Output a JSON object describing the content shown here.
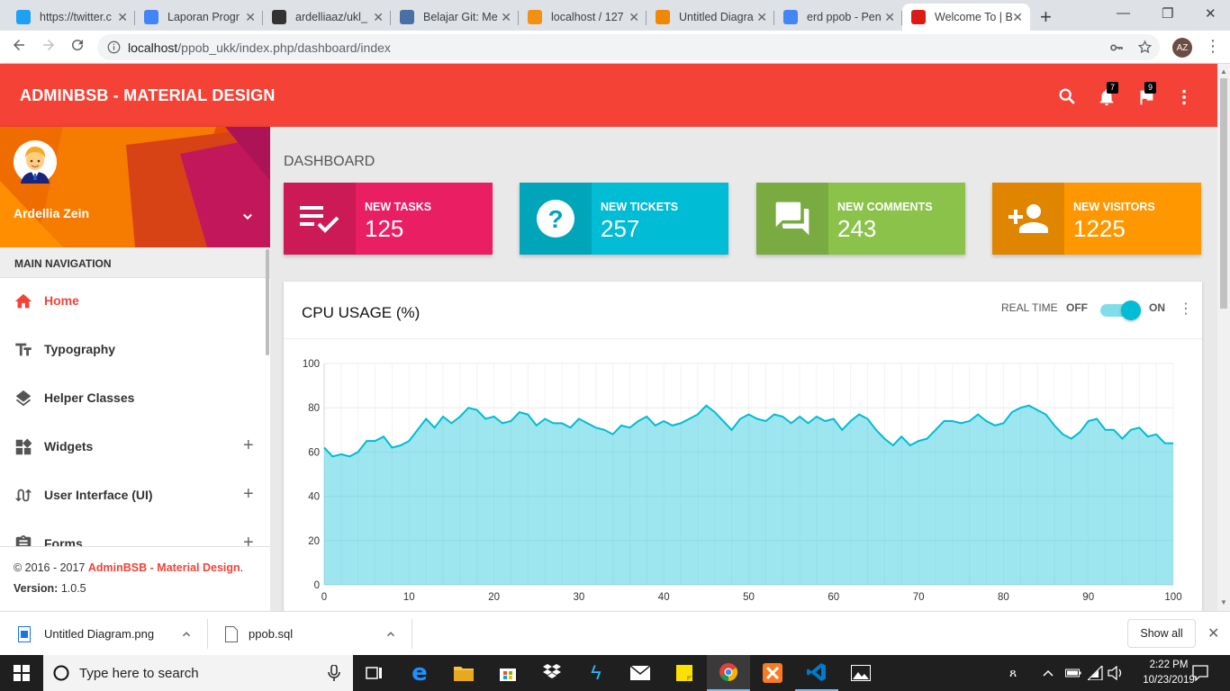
{
  "browser": {
    "tabs": [
      {
        "title": "https://twitter.c",
        "icon": "twitter-icon",
        "color": "#1da1f2"
      },
      {
        "title": "Laporan Progr",
        "icon": "docs-icon",
        "color": "#4285f4"
      },
      {
        "title": "ardelliaaz/ukl_",
        "icon": "github-icon",
        "color": "#333333"
      },
      {
        "title": "Belajar Git: Me",
        "icon": "page-icon",
        "color": "#4a6fa5"
      },
      {
        "title": "localhost / 127",
        "icon": "phpmyadmin-icon",
        "color": "#f29111"
      },
      {
        "title": "Untitled Diagra",
        "icon": "drawio-icon",
        "color": "#f08705"
      },
      {
        "title": "erd ppob - Pen",
        "icon": "google-icon",
        "color": "#4285f4"
      },
      {
        "title": "Welcome To | B",
        "icon": "angular-icon",
        "color": "#dd1b16"
      }
    ],
    "url_host": "localhost",
    "url_path": "/ppob_ukk/index.php/dashboard/index",
    "profile_initials": "AZ"
  },
  "app": {
    "brand": "ADMINBSB - MATERIAL DESIGN",
    "notifications_count": "7",
    "flags_count": "9",
    "accent": "#f44336"
  },
  "sidebar": {
    "user_name": "Ardellia Zein",
    "nav_header": "MAIN NAVIGATION",
    "items": [
      {
        "label": "Home",
        "icon": "home-icon",
        "active": true
      },
      {
        "label": "Typography",
        "icon": "text-fields-icon"
      },
      {
        "label": "Helper Classes",
        "icon": "layers-icon"
      },
      {
        "label": "Widgets",
        "icon": "widgets-icon",
        "expandable": true
      },
      {
        "label": "User Interface (UI)",
        "icon": "swap-calls-icon",
        "expandable": true
      },
      {
        "label": "Forms",
        "icon": "assignment-icon",
        "expandable": true
      }
    ],
    "legal_copyright": "© 2016 - 2017 ",
    "legal_brand": "AdminBSB - Material Design",
    "legal_period": ".",
    "version_label": "Version:",
    "version_value": "1.0.5"
  },
  "dashboard": {
    "title": "DASHBOARD",
    "info_boxes": [
      {
        "label": "NEW TASKS",
        "value": "125",
        "color": "#e91e63",
        "icon": "playlist-check-icon"
      },
      {
        "label": "NEW TICKETS",
        "value": "257",
        "color": "#00bcd4",
        "icon": "help-icon"
      },
      {
        "label": "NEW COMMENTS",
        "value": "243",
        "color": "#8bc34a",
        "icon": "forum-icon"
      },
      {
        "label": "NEW VISITORS",
        "value": "1225",
        "color": "#ff9800",
        "icon": "person-add-icon"
      }
    ],
    "cpu_card": {
      "title": "CPU USAGE (%)",
      "realtime_label": "REAL TIME",
      "off_label": "OFF",
      "on_label": "ON",
      "realtime_on": true
    }
  },
  "chart_data": {
    "type": "area",
    "title": "",
    "xlabel": "",
    "ylabel": "",
    "xlim": [
      0,
      100
    ],
    "ylim": [
      0,
      100
    ],
    "xticks": [
      0,
      10,
      20,
      30,
      40,
      50,
      60,
      70,
      80,
      90,
      100
    ],
    "yticks": [
      0,
      20,
      40,
      60,
      80,
      100
    ],
    "grid": true,
    "color": "#00bcd4",
    "x": [
      0,
      1,
      2,
      3,
      4,
      5,
      6,
      7,
      8,
      9,
      10,
      11,
      12,
      13,
      14,
      15,
      16,
      17,
      18,
      19,
      20,
      21,
      22,
      23,
      24,
      25,
      26,
      27,
      28,
      29,
      30,
      31,
      32,
      33,
      34,
      35,
      36,
      37,
      38,
      39,
      40,
      41,
      42,
      43,
      44,
      45,
      46,
      47,
      48,
      49,
      50,
      51,
      52,
      53,
      54,
      55,
      56,
      57,
      58,
      59,
      60,
      61,
      62,
      63,
      64,
      65,
      66,
      67,
      68,
      69,
      70,
      71,
      72,
      73,
      74,
      75,
      76,
      77,
      78,
      79,
      80,
      81,
      82,
      83,
      84,
      85,
      86,
      87,
      88,
      89,
      90,
      91,
      92,
      93,
      94,
      95,
      96,
      97,
      98,
      99,
      100
    ],
    "y": [
      62,
      58,
      59,
      58,
      60,
      65,
      65,
      67,
      62,
      63,
      65,
      70,
      75,
      71,
      76,
      73,
      76,
      80,
      79,
      75,
      76,
      73,
      74,
      78,
      77,
      72,
      75,
      73,
      73,
      71,
      75,
      73,
      71,
      70,
      68,
      72,
      71,
      74,
      76,
      72,
      74,
      72,
      73,
      75,
      77,
      81,
      78,
      74,
      70,
      75,
      77,
      75,
      74,
      77,
      76,
      73,
      76,
      73,
      76,
      74,
      75,
      70,
      74,
      77,
      75,
      70,
      66,
      63,
      67,
      63,
      65,
      66,
      70,
      74,
      74,
      73,
      74,
      77,
      74,
      72,
      73,
      78,
      80,
      81,
      79,
      77,
      72,
      68,
      66,
      69,
      74,
      75,
      70,
      70,
      66,
      70,
      71,
      67,
      68,
      64,
      64
    ]
  },
  "downloads": {
    "items": [
      {
        "name": "Untitled Diagram.png",
        "icon": "image-file-icon"
      },
      {
        "name": "ppob.sql",
        "icon": "file-icon"
      }
    ],
    "show_all": "Show all"
  },
  "taskbar": {
    "search_placeholder": "Type here to search",
    "time": "2:22 PM",
    "date": "10/23/2019"
  }
}
